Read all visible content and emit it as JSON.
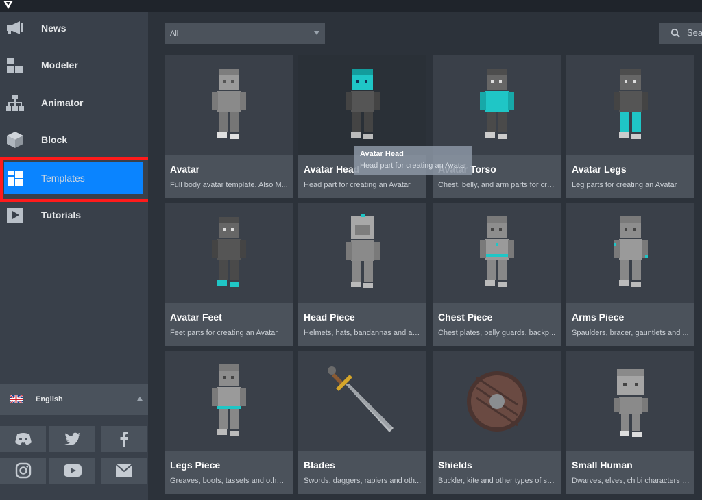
{
  "sidebar": {
    "items": [
      {
        "label": "News",
        "icon": "megaphone-icon"
      },
      {
        "label": "Modeler",
        "icon": "blocks-icon"
      },
      {
        "label": "Animator",
        "icon": "hierarchy-icon"
      },
      {
        "label": "Block",
        "icon": "cube-icon"
      },
      {
        "label": "Templates",
        "icon": "templates-icon",
        "active": true
      },
      {
        "label": "Tutorials",
        "icon": "play-icon"
      }
    ],
    "language": "English"
  },
  "social": [
    "discord",
    "twitter",
    "facebook",
    "instagram",
    "youtube",
    "email"
  ],
  "filter": {
    "selected": "All"
  },
  "search": {
    "placeholder": "Search"
  },
  "cards": [
    {
      "title": "Avatar",
      "desc": "Full body avatar template. Also M..."
    },
    {
      "title": "Avatar Head",
      "desc": "Head part for creating an Avatar"
    },
    {
      "title": "Avatar Torso",
      "desc": "Chest, belly, and arm parts for cre..."
    },
    {
      "title": "Avatar Legs",
      "desc": "Leg parts for creating an Avatar"
    },
    {
      "title": "Avatar Feet",
      "desc": "Feet parts for creating an Avatar"
    },
    {
      "title": "Head Piece",
      "desc": "Helmets, hats, bandannas and ac..."
    },
    {
      "title": "Chest Piece",
      "desc": "Chest plates, belly guards, backp..."
    },
    {
      "title": "Arms Piece",
      "desc": "Spaulders, bracer, gauntlets and ..."
    },
    {
      "title": "Legs Piece",
      "desc": "Greaves, boots, tassets and other..."
    },
    {
      "title": "Blades",
      "desc": "Swords, daggers, rapiers and oth..."
    },
    {
      "title": "Shields",
      "desc": "Buckler, kite and other types of sh..."
    },
    {
      "title": "Small Human",
      "desc": "Dwarves, elves, chibi characters a..."
    }
  ],
  "tooltip": {
    "title": "Avatar Head",
    "desc": "Head part for creating an Avatar"
  },
  "colors": {
    "accent": "#0a84ff",
    "highlight": "#ff1b1b",
    "teal": "#1fc6c6"
  }
}
